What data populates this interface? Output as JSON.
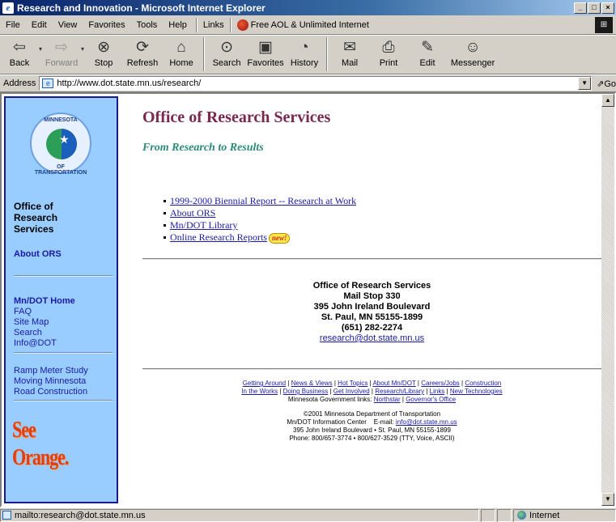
{
  "window": {
    "title": "Research and Innovation - Microsoft Internet Explorer",
    "controls": [
      "_",
      "□",
      "×"
    ]
  },
  "menubar": {
    "items": [
      "File",
      "Edit",
      "View",
      "Favorites",
      "Tools",
      "Help"
    ],
    "links_label": "Links",
    "aol_link": "Free AOL & Unlimited Internet"
  },
  "toolbar": {
    "buttons": [
      {
        "label": "Back",
        "icon": "back-arrow-icon"
      },
      {
        "label": "Forward",
        "icon": "forward-arrow-icon"
      },
      {
        "label": "Stop",
        "icon": "stop-icon"
      },
      {
        "label": "Refresh",
        "icon": "refresh-icon"
      },
      {
        "label": "Home",
        "icon": "home-icon"
      },
      {
        "label": "Search",
        "icon": "search-icon"
      },
      {
        "label": "Favorites",
        "icon": "favorites-icon"
      },
      {
        "label": "History",
        "icon": "history-icon"
      },
      {
        "label": "Mail",
        "icon": "mail-icon"
      },
      {
        "label": "Print",
        "icon": "print-icon"
      },
      {
        "label": "Edit",
        "icon": "edit-icon"
      },
      {
        "label": "Messenger",
        "icon": "messenger-icon"
      }
    ]
  },
  "address": {
    "label": "Address",
    "url": "http://www.dot.state.mn.us/research/",
    "go_label": "Go"
  },
  "sidebar": {
    "logo_text_top": "MINNESOTA",
    "logo_text_bottom": "OF TRANSPORTATION",
    "heading_line1": "Office of",
    "heading_line2": "Research",
    "heading_line3": "Services",
    "about": "About ORS",
    "links1": [
      "Mn/DOT Home",
      "FAQ",
      "Site Map",
      "Search",
      "Info@DOT"
    ],
    "links2": [
      "Ramp Meter Study",
      "Moving Minnesota",
      "Road Construction"
    ],
    "see_orange": "See Orange."
  },
  "main": {
    "title": "Office of Research Services",
    "subtitle": "From Research to Results",
    "links": [
      "1999-2000 Biennial Report -- Research at Work",
      "About ORS",
      "Mn/DOT Library",
      "Online Research Reports"
    ],
    "new_badge": "new!",
    "contact": {
      "line1": "Office of Research Services",
      "line2": "Mail Stop 330",
      "line3": "395 John Ireland Boulevard",
      "line4": "St. Paul, MN 55155-1899",
      "line5": "(651) 282-2274",
      "email": "research@dot.state.mn.us"
    }
  },
  "footer": {
    "row1": [
      "Getting Around",
      "News & Views",
      "Hot Topics",
      "About Mn/DOT",
      "Careers/Jobs",
      "Construction"
    ],
    "row2": [
      "In the Works",
      "Doing Business",
      "Get Involved",
      "Research/Library",
      "Links",
      "New Technologies"
    ],
    "gov_label": "Minnesota Government links:",
    "gov_links": [
      "Northstar",
      "Governor's Office"
    ],
    "copyright": "©2001 Minnesota Department of Transportation",
    "info_center": "Mn/DOT Information Center",
    "email_label": "E-mail:",
    "email": "info@dot.state.mn.us",
    "address": "395 John Ireland Boulevard • St. Paul, MN 55155-1899",
    "phone": "Phone: 800/657-3774 • 800/627-3529 (TTY, Voice, ASCII)"
  },
  "status": {
    "text": "mailto:research@dot.state.mn.us",
    "zone": "Internet"
  },
  "colors": {
    "sidebar_bg": "#99ccff",
    "title_color": "#7a2850",
    "subtitle_color": "#2a8a7a",
    "link_color": "#1a1aa6"
  }
}
